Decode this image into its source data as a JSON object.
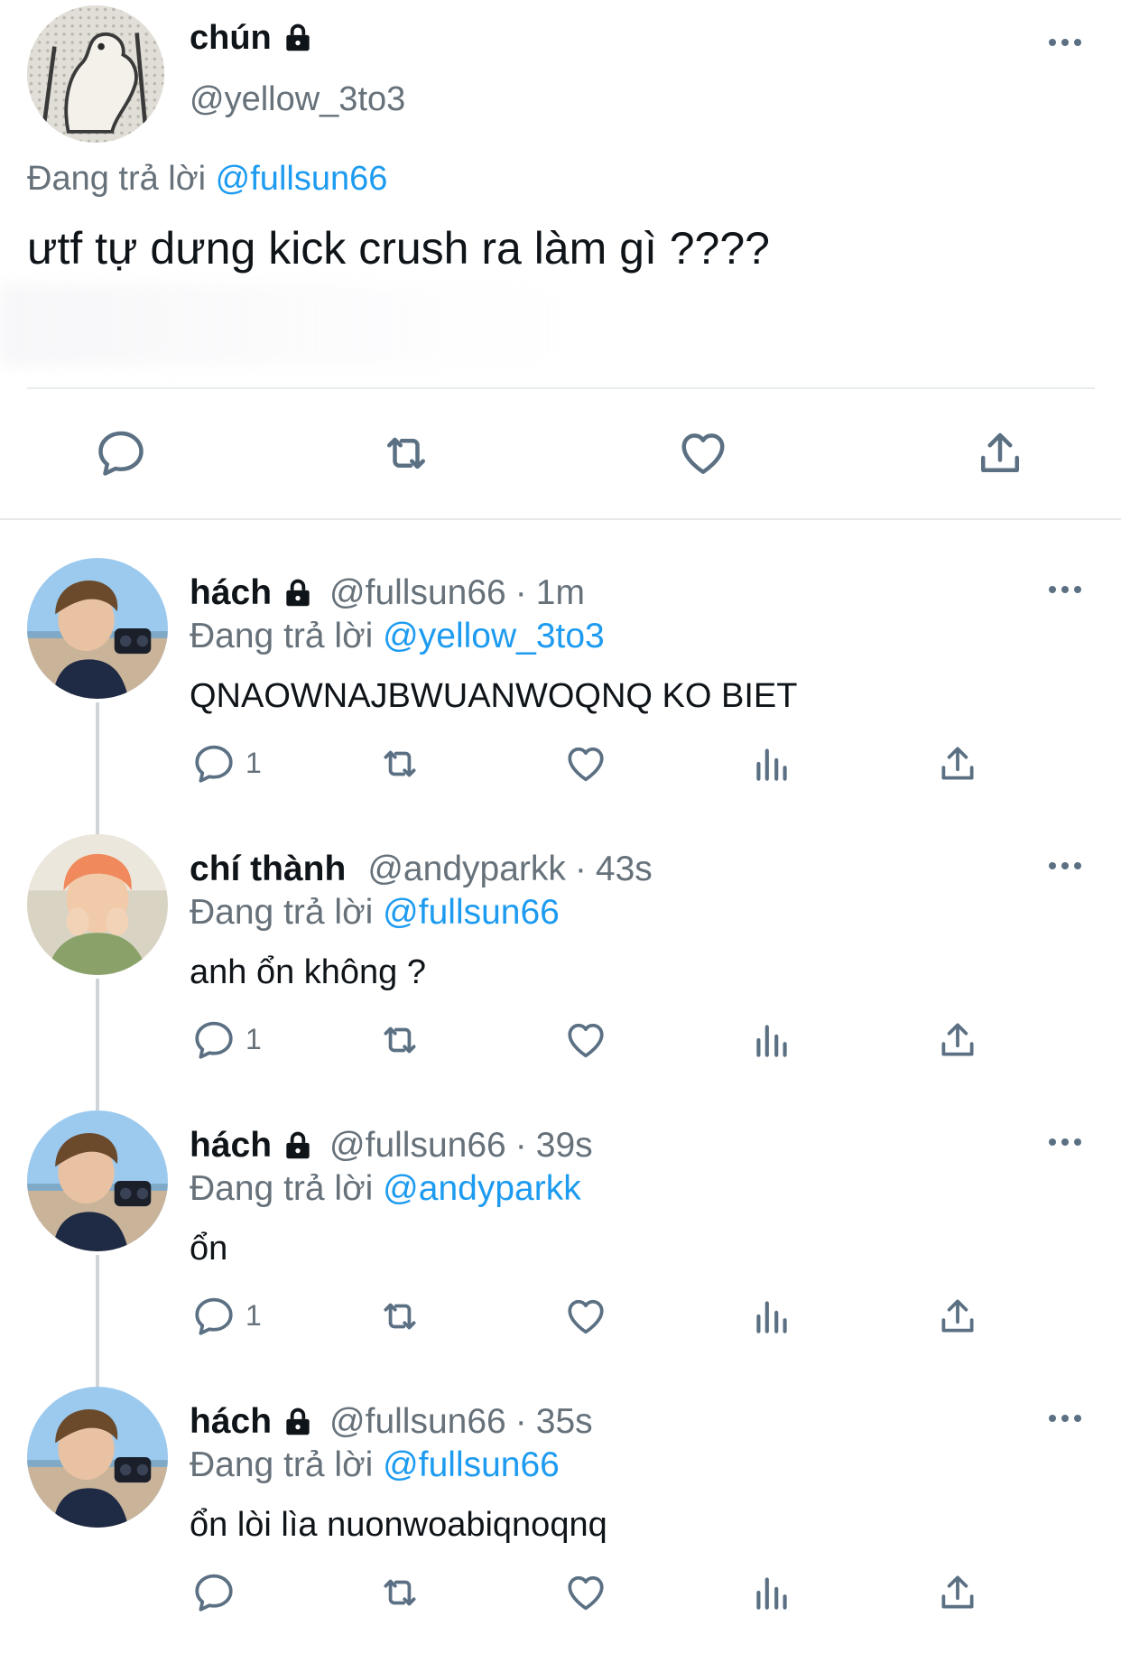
{
  "main_tweet": {
    "display_name": "chún",
    "handle": "@yellow_3to3",
    "replying_prefix": "Đang trả lời",
    "replying_to": "@fullsun66",
    "text": "ưtf tự dưng kick crush ra làm gì ????"
  },
  "replies": [
    {
      "display_name": "hách",
      "handle": "@fullsun66",
      "separator": "·",
      "time": "1m",
      "replying_prefix": "Đang trả lời",
      "replying_to": "@yellow_3to3",
      "text": "QNAOWNAJBWUANWOQNQ KO BIET",
      "reply_count": "1",
      "locked": true
    },
    {
      "display_name": "chí thành",
      "handle": "@andyparkk",
      "separator": "·",
      "time": "43s",
      "replying_prefix": "Đang trả lời",
      "replying_to": "@fullsun66",
      "text": "anh ổn không ?",
      "reply_count": "1",
      "locked": false
    },
    {
      "display_name": "hách",
      "handle": "@fullsun66",
      "separator": "·",
      "time": "39s",
      "replying_prefix": "Đang trả lời",
      "replying_to": "@andyparkk",
      "text": "ổn",
      "reply_count": "1",
      "locked": true
    },
    {
      "display_name": "hách",
      "handle": "@fullsun66",
      "separator": "·",
      "time": "35s",
      "replying_prefix": "Đang trả lời",
      "replying_to": "@fullsun66",
      "text": "ổn lòi lìa nuonwoabiqnoqnq",
      "reply_count": "",
      "locked": true
    }
  ],
  "colors": {
    "link": "#1d9bf0",
    "secondary_text": "#66717a",
    "primary_text": "#0f1419",
    "icon": "#5b7083",
    "divider": "#e9ecee"
  },
  "icons": {
    "reply": "speech-bubble-icon",
    "retweet": "retweet-arrows-icon",
    "like": "heart-icon",
    "views": "bar-chart-icon",
    "share": "share-upload-icon",
    "more": "three-dots-icon",
    "protected": "padlock-icon"
  }
}
